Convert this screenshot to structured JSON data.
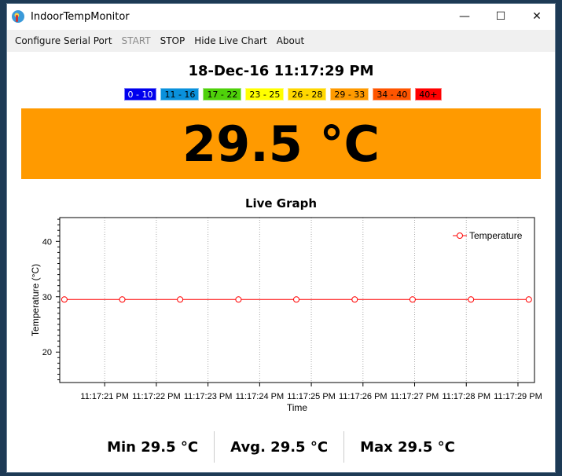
{
  "window": {
    "title": "IndoorTempMonitor",
    "minimize": "—",
    "maximize": "☐",
    "close": "✕"
  },
  "menu": [
    {
      "label": "Configure Serial Port",
      "enabled": true
    },
    {
      "label": "START",
      "enabled": false
    },
    {
      "label": "STOP",
      "enabled": true
    },
    {
      "label": "Hide Live Chart",
      "enabled": true
    },
    {
      "label": "About",
      "enabled": true
    }
  ],
  "datetime": "18-Dec-16 11:17:29 PM",
  "ranges": [
    {
      "label": "0 - 10",
      "bg": "#0000ee",
      "fg": "#ffffff"
    },
    {
      "label": "11 - 16",
      "bg": "#0a91dc",
      "fg": "#000000"
    },
    {
      "label": "17 - 22",
      "bg": "#4fd10a",
      "fg": "#000000"
    },
    {
      "label": "23 - 25",
      "bg": "#ffff00",
      "fg": "#000000"
    },
    {
      "label": "26 - 28",
      "bg": "#ffd700",
      "fg": "#000000"
    },
    {
      "label": "29 - 33",
      "bg": "#ff9a00",
      "fg": "#000000"
    },
    {
      "label": "34 - 40",
      "bg": "#ff5500",
      "fg": "#000000"
    },
    {
      "label": "40+",
      "bg": "#ff0000",
      "fg": "#000000"
    }
  ],
  "current": {
    "text": "29.5 °C",
    "bg": "#ff9a00"
  },
  "graph_title": "Live Graph",
  "chart_data": {
    "type": "line",
    "title": "Live Graph",
    "xlabel": "Time",
    "ylabel": "Temperature (°C)",
    "ylim": [
      14.5,
      44.3
    ],
    "xlim_seconds": [
      20.13,
      29.32
    ],
    "yticks": [
      20,
      30,
      40
    ],
    "xticks": [
      21,
      22,
      23,
      24,
      25,
      26,
      27,
      28,
      29
    ],
    "xtick_labels": [
      "11:17:21 PM",
      "11:17:22 PM",
      "11:17:23 PM",
      "11:17:24 PM",
      "11:17:25 PM",
      "11:17:26 PM",
      "11:17:27 PM",
      "11:17:28 PM",
      "11:17:29 PM"
    ],
    "grid": "vertical-dotted",
    "legend_position": "top-right",
    "series": [
      {
        "name": "Temperature",
        "color": "#ff0000",
        "x_seconds": [
          20.22,
          21.34,
          22.46,
          23.59,
          24.71,
          25.84,
          26.96,
          28.09,
          29.21
        ],
        "y": [
          29.5,
          29.5,
          29.5,
          29.5,
          29.5,
          29.5,
          29.5,
          29.5,
          29.5
        ]
      }
    ]
  },
  "stats": {
    "min": "Min 29.5 °C",
    "avg": "Avg. 29.5 °C",
    "max": "Max 29.5 °C"
  }
}
